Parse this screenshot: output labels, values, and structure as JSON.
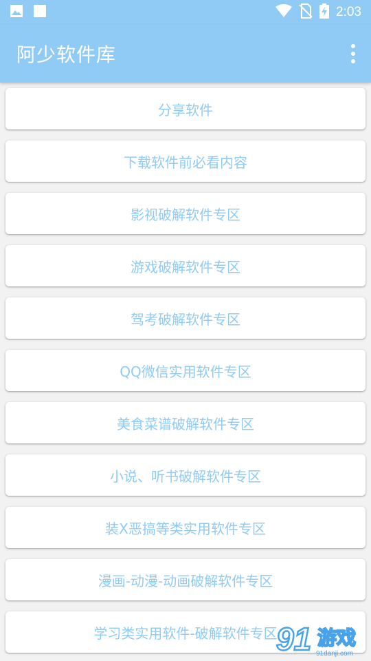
{
  "status_bar": {
    "time": "2:03",
    "left_icons": [
      "image-icon",
      "square-icon"
    ],
    "right_icons": [
      "wifi-icon",
      "no-sim-icon",
      "battery-charging-icon"
    ]
  },
  "app_bar": {
    "title": "阿少软件库",
    "menu_icon": "more-vert-icon"
  },
  "menu_items": [
    {
      "label": "分享软件"
    },
    {
      "label": "下载软件前必看内容"
    },
    {
      "label": "影视破解软件专区"
    },
    {
      "label": "游戏破解软件专区"
    },
    {
      "label": "驾考破解软件专区"
    },
    {
      "label": "QQ微信实用软件专区"
    },
    {
      "label": "美食菜谱破解软件专区"
    },
    {
      "label": "小说、听书破解软件专区"
    },
    {
      "label": "装X恶搞等类实用软件专区"
    },
    {
      "label": "漫画-动漫-动画破解软件专区"
    },
    {
      "label": "学习类实用软件-破解软件专区"
    }
  ],
  "watermark": {
    "logo_text": "游戏",
    "site": "91danji.com"
  },
  "colors": {
    "primary": "#90cbf6",
    "label": "#90cbf6",
    "background": "#f2f2f2",
    "card": "#ffffff"
  }
}
